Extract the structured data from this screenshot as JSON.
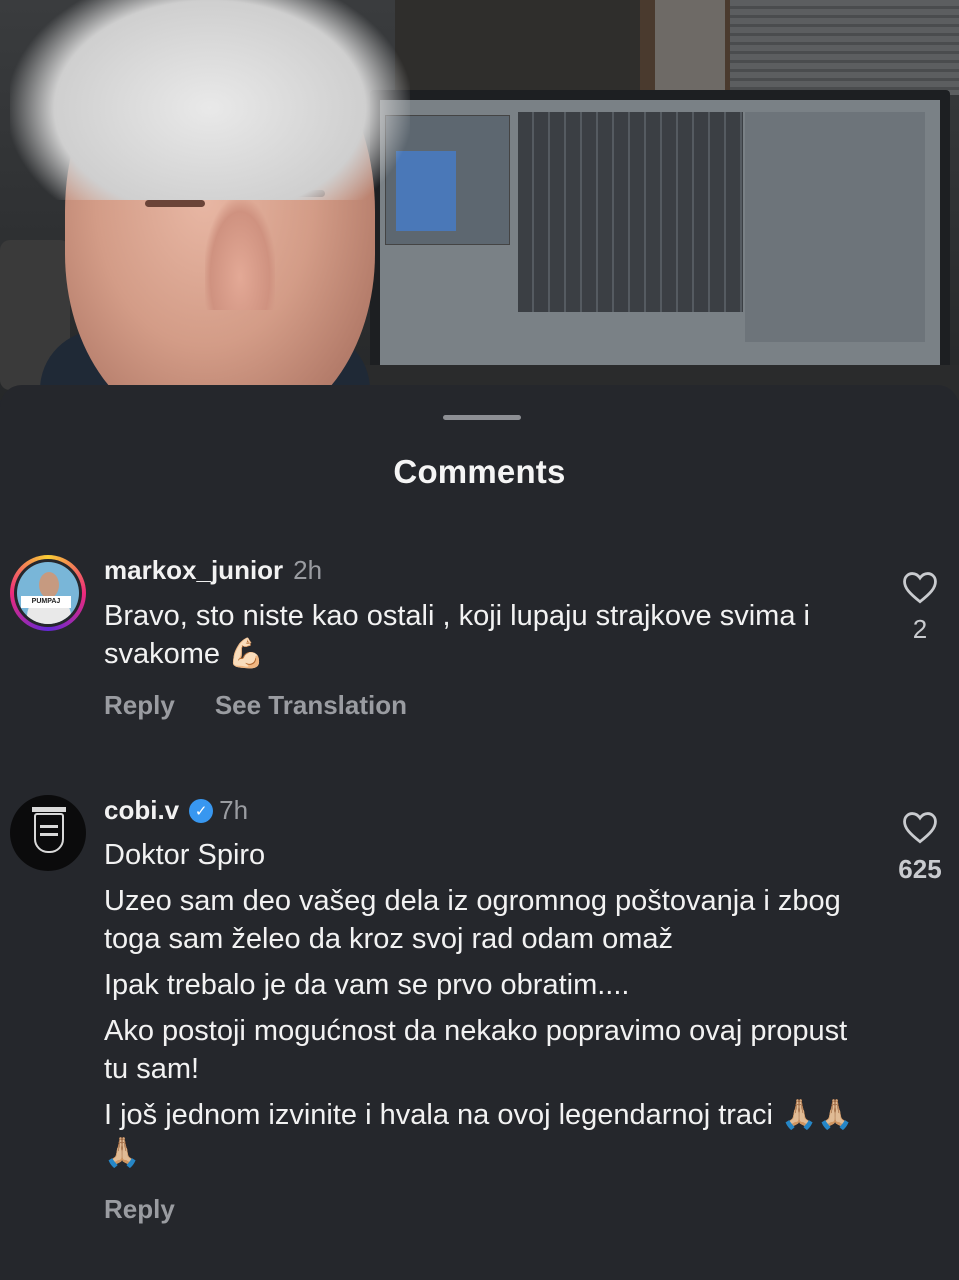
{
  "sheet": {
    "title": "Comments"
  },
  "comments": [
    {
      "username": "markox_junior",
      "time": "2h",
      "verified": false,
      "avatar_badge_text": "PUMPAJ",
      "paragraphs": [
        "Bravo, sto niste kao ostali , koji lupaju strajkove svima i svakome 💪🏻"
      ],
      "likes": "2",
      "actions": {
        "reply": "Reply",
        "translate": "See Translation"
      }
    },
    {
      "username": "cobi.v",
      "time": "7h",
      "verified": true,
      "paragraphs": [
        "Doktor Spiro",
        "Uzeo sam deo vašeg dela iz ogromnog poštovanja i zbog toga sam želeo da kroz svoj rad odam omaž",
        "Ipak trebalo je da vam se prvo obratim....",
        "Ako postoji mogućnost da nekako popravimo ovaj propust tu sam!",
        "I još jednom izvinite i hvala na ovoj legendarnoj traci 🙏🏼🙏🏼🙏🏼"
      ],
      "likes": "625",
      "actions": {
        "reply": "Reply"
      }
    }
  ],
  "icons": {
    "like": "heart-outline-icon",
    "verified": "verified-badge-icon"
  },
  "colors": {
    "sheet_background": "#25272c",
    "secondary_text": "#9a9ca1",
    "verified_blue": "#3897f0"
  }
}
